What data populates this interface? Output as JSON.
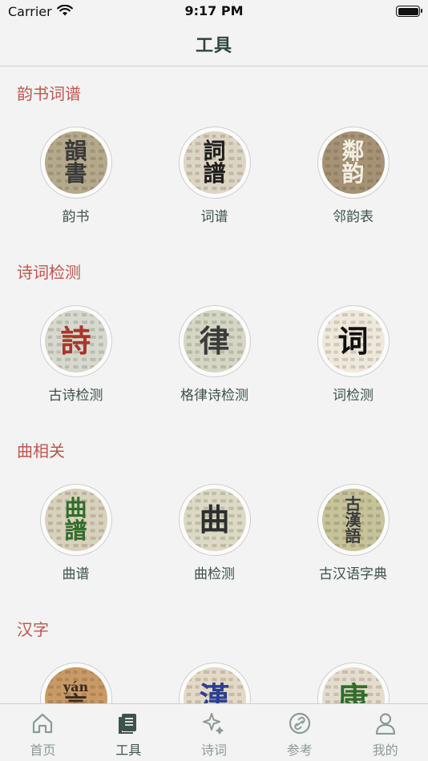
{
  "status_bar": {
    "carrier": "Carrier",
    "time": "9:17 PM"
  },
  "nav": {
    "title": "工具"
  },
  "sections": [
    {
      "title": "韵书词谱",
      "items": [
        {
          "label": "韵书",
          "glyphs": [
            "韻",
            "書"
          ],
          "glyph_color": "#3a3a3a",
          "bg": "#b5a98c"
        },
        {
          "label": "词谱",
          "glyphs": [
            "詞",
            "譜"
          ],
          "glyph_color": "#1e1e1e",
          "bg": "#ddd5c4"
        },
        {
          "label": "邻韵表",
          "glyphs": [
            "鄰",
            "韵"
          ],
          "glyph_color": "#f4efe4",
          "bg": "#a69274"
        }
      ]
    },
    {
      "title": "诗词检测",
      "items": [
        {
          "label": "古诗检测",
          "glyphs": [
            "詩"
          ],
          "glyph_color": "#a7362c",
          "bg": "#d7d9cf"
        },
        {
          "label": "格律诗检测",
          "glyphs": [
            "律"
          ],
          "glyph_color": "#3b3b3b",
          "bg": "#d5d6c4"
        },
        {
          "label": "词检测",
          "glyphs": [
            "词"
          ],
          "glyph_color": "#111111",
          "bg": "#efe9dc"
        }
      ]
    },
    {
      "title": "曲相关",
      "items": [
        {
          "label": "曲谱",
          "glyphs": [
            "曲",
            "譜"
          ],
          "glyph_color": "#2f6e2a",
          "bg": "#d8d1bc"
        },
        {
          "label": "曲检测",
          "glyphs": [
            "曲"
          ],
          "glyph_color": "#2e2e2e",
          "bg": "#dcd9c4"
        },
        {
          "label": "古汉语字典",
          "glyphs": [
            "古",
            "漢",
            "語"
          ],
          "glyph_color": "#3a3a3a",
          "bg": "#c7c39a"
        }
      ]
    },
    {
      "title": "汉字",
      "items": [
        {
          "label": "",
          "glyphs": [
            "yán",
            "言"
          ],
          "glyph_color": "#3a2a20",
          "bg": "#c99a65"
        },
        {
          "label": "",
          "glyphs": [
            "漢"
          ],
          "glyph_color": "#2a3e93",
          "bg": "#e3d9c6"
        },
        {
          "label": "",
          "glyphs": [
            "康"
          ],
          "glyph_color": "#2f6e2a",
          "bg": "#e4ddcd"
        }
      ]
    }
  ],
  "tabs": [
    {
      "label": "首页",
      "icon": "home-icon",
      "active": false
    },
    {
      "label": "工具",
      "icon": "book-icon",
      "active": true
    },
    {
      "label": "诗词",
      "icon": "sparkle-icon",
      "active": false
    },
    {
      "label": "参考",
      "icon": "link-icon",
      "active": false
    },
    {
      "label": "我的",
      "icon": "person-icon",
      "active": false
    }
  ],
  "colors": {
    "accent": "#3d524c",
    "section_title": "#c0564d",
    "inactive": "#8d9a96"
  }
}
